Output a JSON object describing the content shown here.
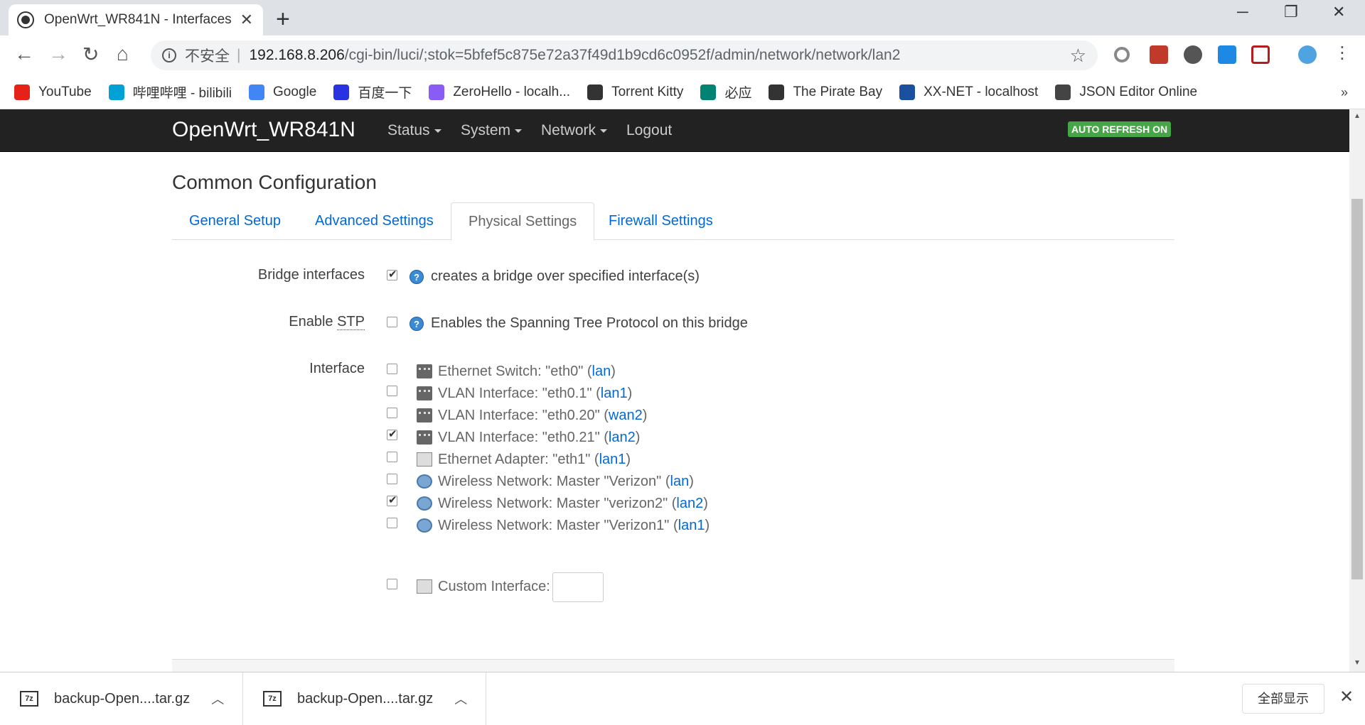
{
  "browser": {
    "tab_title": "OpenWrt_WR841N - Interfaces",
    "new_tab": "+",
    "window": {
      "minimize": "─",
      "restore": "❐",
      "close": "✕"
    },
    "url_security": "不安全",
    "url_host": "192.168.8.206",
    "url_path": "/cgi-bin/luci/;stok=5bfef5c875e72a37f49d1b9cd6c0952f/admin/network/network/lan2",
    "bookmarks": [
      {
        "label": "YouTube",
        "icon": "youtube-icon",
        "color": "#e62117"
      },
      {
        "label": "哔哩哔哩 - bilibili",
        "icon": "bilibili-icon",
        "color": "#00a1d6"
      },
      {
        "label": "Google",
        "icon": "google-icon",
        "color": "#4285f4"
      },
      {
        "label": "百度一下",
        "icon": "baidu-icon",
        "color": "#2932e1"
      },
      {
        "label": "ZeroHello - localh...",
        "icon": "zeronet-icon",
        "color": "#8a5cf6"
      },
      {
        "label": "Torrent Kitty",
        "icon": "kitty-icon",
        "color": "#333333"
      },
      {
        "label": "必应",
        "icon": "bing-icon",
        "color": "#008373"
      },
      {
        "label": "The Pirate Bay",
        "icon": "pirate-ship-icon",
        "color": "#333333"
      },
      {
        "label": "XX-NET - localhost",
        "icon": "xxnet-icon",
        "color": "#1b4fa0"
      },
      {
        "label": "JSON Editor Online",
        "icon": "json-icon",
        "color": "#444444"
      }
    ],
    "bookmarks_more": "»"
  },
  "luci": {
    "brand": "OpenWrt_WR841N",
    "menu": [
      "Status",
      "System",
      "Network",
      "Logout"
    ],
    "auto_refresh": "AUTO REFRESH ON",
    "section_title": "Common Configuration",
    "tabs": [
      "General Setup",
      "Advanced Settings",
      "Physical Settings",
      "Firewall Settings"
    ],
    "active_tab": "Physical Settings",
    "bridge": {
      "label": "Bridge interfaces",
      "checked": true,
      "help": "creates a bridge over specified interface(s)"
    },
    "stp": {
      "label_prefix": "Enable ",
      "label_abbr": "STP",
      "checked": false,
      "help": "Enables the Spanning Tree Protocol on this bridge"
    },
    "interface_label": "Interface",
    "interfaces": [
      {
        "name": "Ethernet Switch: \"eth0\"",
        "net": "lan",
        "checked": false,
        "icon": "switch"
      },
      {
        "name": "VLAN Interface: \"eth0.1\"",
        "net": "lan1",
        "checked": false,
        "icon": "switch"
      },
      {
        "name": "VLAN Interface: \"eth0.20\"",
        "net": "wan2",
        "checked": false,
        "icon": "switch"
      },
      {
        "name": "VLAN Interface: \"eth0.21\"",
        "net": "lan2",
        "checked": true,
        "icon": "switch"
      },
      {
        "name": "Ethernet Adapter: \"eth1\"",
        "net": "lan1",
        "checked": false,
        "icon": "ethernet"
      },
      {
        "name": "Wireless Network: Master \"Verizon\"",
        "net": "lan",
        "checked": false,
        "icon": "wifi"
      },
      {
        "name": "Wireless Network: Master \"verizon2\"",
        "net": "lan2",
        "checked": true,
        "icon": "wifi"
      },
      {
        "name": "Wireless Network: Master \"Verizon1\"",
        "net": "lan1",
        "checked": false,
        "icon": "wifi"
      }
    ],
    "custom_interface": {
      "label": "Custom Interface:",
      "value": "",
      "checked": false
    }
  },
  "downloads": {
    "items": [
      "backup-Open....tar.gz",
      "backup-Open....tar.gz"
    ],
    "file_type": "7z",
    "show_all": "全部显示",
    "close": "✕"
  },
  "colors": {
    "navbar": "#222222",
    "link": "#0069d6",
    "refresh_badge": "#46a546"
  }
}
